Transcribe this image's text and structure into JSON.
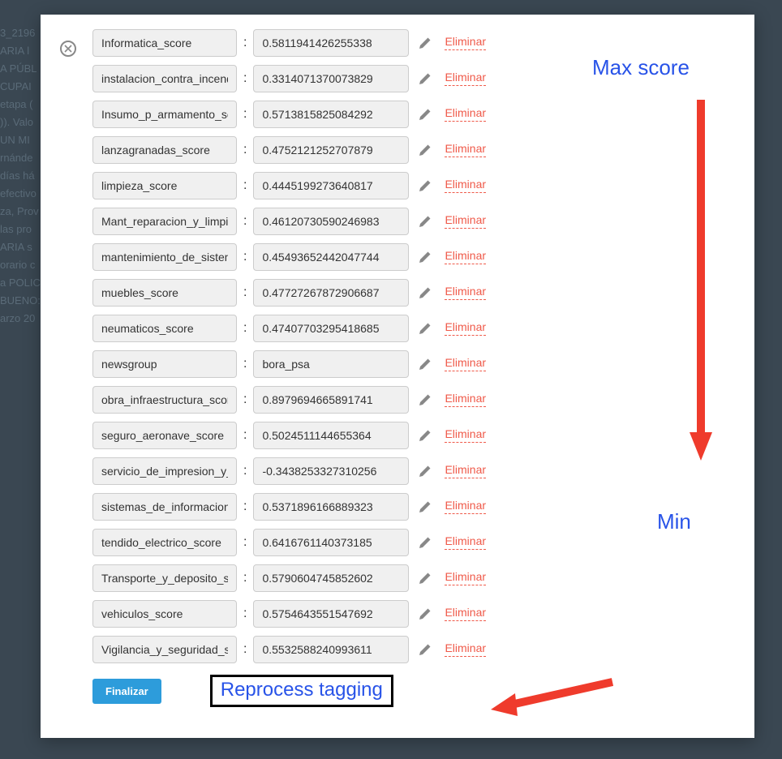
{
  "backdrop_text": "3_2196\nARIA  l\nA PÚBL\nCUPAI\n etapa (\n)). Valo\n UN MI\nrnánde\n días há\nefectivo\nza, Prov\n las pro\nARIA s\norario c\na POLIC\nBUENO:\narzo 20",
  "actions": {
    "close_title": "Close",
    "delete_label": "Eliminar",
    "finalize_label": "Finalizar"
  },
  "rows": [
    {
      "key": "Informatica_score",
      "value": "0.5811941426255338"
    },
    {
      "key": "instalacion_contra_incend",
      "value": "0.3314071370073829"
    },
    {
      "key": "Insumo_p_armamento_sc",
      "value": "0.5713815825084292"
    },
    {
      "key": "lanzagranadas_score",
      "value": "0.4752121252707879"
    },
    {
      "key": "limpieza_score",
      "value": "0.4445199273640817"
    },
    {
      "key": "Mant_reparacion_y_limpie",
      "value": "0.46120730590246983"
    },
    {
      "key": "mantenimiento_de_sistem",
      "value": "0.45493652442047744"
    },
    {
      "key": "muebles_score",
      "value": "0.47727267872906687"
    },
    {
      "key": "neumaticos_score",
      "value": "0.47407703295418685"
    },
    {
      "key": "newsgroup",
      "value": "bora_psa"
    },
    {
      "key": "obra_infraestructura_score",
      "value": "0.8979694665891741"
    },
    {
      "key": "seguro_aeronave_score",
      "value": "0.5024511144655364"
    },
    {
      "key": "servicio_de_impresion_y_t",
      "value": "-0.3438253327310256"
    },
    {
      "key": "sistemas_de_informacion_",
      "value": "0.5371896166889323"
    },
    {
      "key": "tendido_electrico_score",
      "value": "0.6416761140373185"
    },
    {
      "key": "Transporte_y_deposito_sc",
      "value": "0.5790604745852602"
    },
    {
      "key": "vehiculos_score",
      "value": "0.5754643551547692"
    },
    {
      "key": "Vigilancia_y_seguridad_sc",
      "value": "0.5532588240993611"
    }
  ],
  "annotations": {
    "max_label": "Max score",
    "min_label": "Min",
    "reprocess_label": "Reprocess tagging"
  }
}
